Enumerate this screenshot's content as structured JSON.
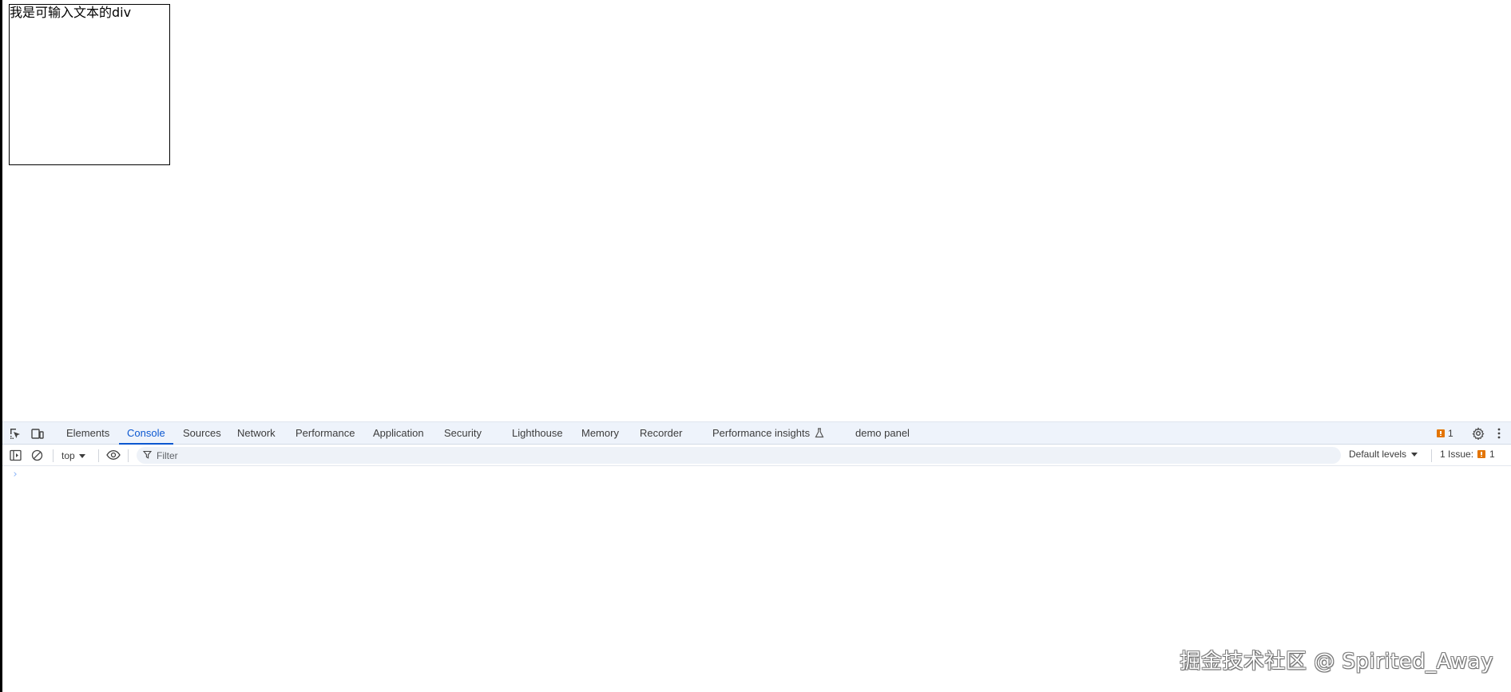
{
  "page": {
    "editable_text": "我是可输入文本的div"
  },
  "devtools": {
    "tabs": [
      {
        "label": "Elements"
      },
      {
        "label": "Console"
      },
      {
        "label": "Sources"
      },
      {
        "label": "Network"
      },
      {
        "label": "Performance"
      },
      {
        "label": "Application"
      },
      {
        "label": "Security"
      },
      {
        "label": "Lighthouse"
      },
      {
        "label": "Memory"
      },
      {
        "label": "Recorder"
      },
      {
        "label": "Performance insights"
      },
      {
        "label": "demo panel"
      }
    ],
    "active_tab": "Console",
    "issues_badge_count": "1",
    "toolbar": {
      "context": "top",
      "filter_placeholder": "Filter",
      "levels": "Default levels",
      "issues_label": "1 Issue:",
      "issues_count": "1"
    },
    "prompt_symbol": "›"
  },
  "watermark": "掘金技术社区 @ Spirited_Away",
  "colors": {
    "accent": "#0b57d0",
    "tabbar_bg": "#eef3fb",
    "issue_flag": "#e37400"
  }
}
